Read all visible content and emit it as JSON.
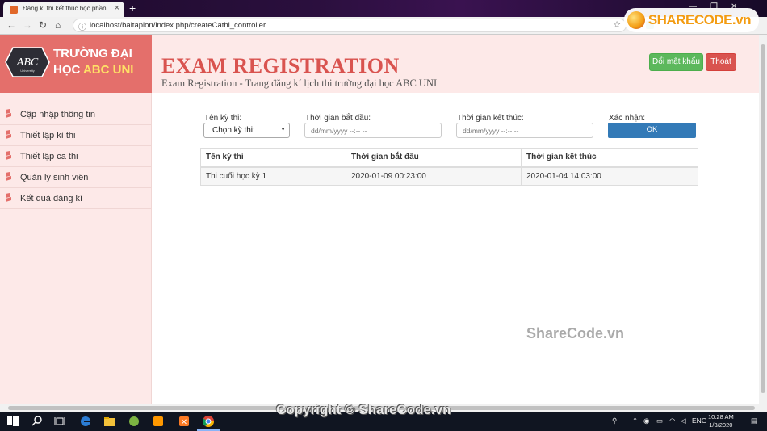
{
  "browser": {
    "tab_title": "Đăng kí thi kết thúc học phần",
    "url": "localhost/baitaplon/index.php/createCathi_controller"
  },
  "watermark_badge": "SHARECODE.vn",
  "brand": {
    "logo_text": "ABC",
    "logo_sub": "University",
    "line1": "TRƯỜNG ĐẠI",
    "line2_a": "HỌC ",
    "line2_b": "ABC UNI"
  },
  "header": {
    "title": "EXAM REGISTRATION",
    "subtitle": "Exam Registration - Trang đăng kí lịch thi trường đại học ABC UNI",
    "change_password": "Đổi mật khẩu",
    "logout": "Thoát"
  },
  "sidebar": {
    "items": [
      {
        "label": "Cập nhập thông tin"
      },
      {
        "label": "Thiết lập kì thi"
      },
      {
        "label": "Thiết lập ca thi"
      },
      {
        "label": "Quản lý sinh viên"
      },
      {
        "label": "Kết quả đăng kí"
      }
    ]
  },
  "form": {
    "exam_label": "Tên kỳ thi:",
    "exam_select": "Chọn kỳ thi:",
    "start_label": "Thời gian bắt đầu:",
    "start_placeholder": "dd/mm/yyyy --:-- --",
    "end_label": "Thời gian kết thúc:",
    "end_placeholder": "dd/mm/yyyy --:-- --",
    "confirm_label": "Xác nhận:",
    "ok": "OK"
  },
  "table": {
    "headers": [
      "Tên kỳ thi",
      "Thời gian bắt đầu",
      "Thời gian kết thúc"
    ],
    "rows": [
      [
        "Thi cuối học kỳ 1",
        "2020-01-09 00:23:00",
        "2020-01-04 14:03:00"
      ]
    ]
  },
  "page_watermark": "ShareCode.vn",
  "copyright": "Copyright © ShareCode.vn",
  "taskbar": {
    "language": "ENG",
    "time": "10:28 AM",
    "date": "1/3/2020"
  }
}
